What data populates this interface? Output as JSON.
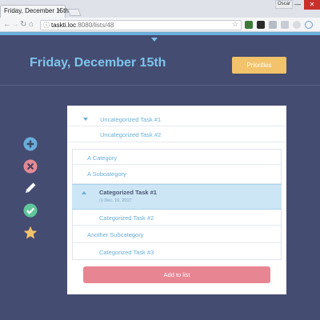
{
  "browser": {
    "tab_title": "Friday, December 15th",
    "tab_close": "×",
    "window_user": "Oscar",
    "window_minimize": "—",
    "window_close": "✕",
    "url_info": "ⓘ",
    "url_host": "taskti.loc",
    "url_rest": ":8080/lists/48",
    "back": "←",
    "forward": "→",
    "reload": "↻",
    "home": "⌂",
    "bookmark": "☆"
  },
  "header": {
    "title": "Friday, December 15th",
    "priorities_label": "Priorities"
  },
  "sidebar": {
    "icons": [
      "plus-circle-icon",
      "x-circle-icon",
      "pencil-icon",
      "check-circle-icon",
      "star-icon"
    ]
  },
  "list": {
    "rows": [
      {
        "label": "Uncategorized Task #1"
      },
      {
        "label": "Uncategorized Task #2"
      },
      {
        "label": "A Category"
      },
      {
        "label": "A Subcategory"
      },
      {
        "label": "Categorized Task #1",
        "date": "◷ Dec. 16, 2017"
      },
      {
        "label": "Categorized Task #2"
      },
      {
        "label": "Another Subcategory"
      },
      {
        "label": "Categorized Task #3"
      }
    ],
    "add_label": "Add to list"
  },
  "colors": {
    "background": "#454c71",
    "accent": "#7ec4ec",
    "priorities": "#f2c36a",
    "add_button": "#e88592",
    "selected_row": "#cde6f6"
  }
}
